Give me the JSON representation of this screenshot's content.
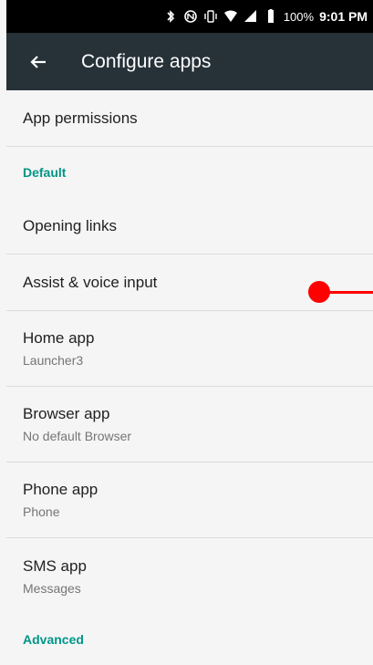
{
  "status_bar": {
    "battery": "100%",
    "time": "9:01 PM",
    "icons": [
      "bluetooth-icon",
      "nfc-icon",
      "vibrate-icon",
      "wifi-icon",
      "cell-signal-icon",
      "battery-icon"
    ]
  },
  "app_bar": {
    "title": "Configure apps",
    "background": "#263238"
  },
  "list": {
    "app_permissions": "App permissions",
    "default_header": "Default",
    "opening_links": "Opening links",
    "assist_voice": "Assist & voice input",
    "home_app": {
      "title": "Home app",
      "value": "Launcher3"
    },
    "browser_app": {
      "title": "Browser app",
      "value": "No default Browser"
    },
    "phone_app": {
      "title": "Phone app",
      "value": "Phone"
    },
    "sms_app": {
      "title": "SMS app",
      "value": "Messages"
    },
    "advanced_header": "Advanced"
  },
  "colors": {
    "accent": "#009688",
    "marker": "#ff0000"
  }
}
